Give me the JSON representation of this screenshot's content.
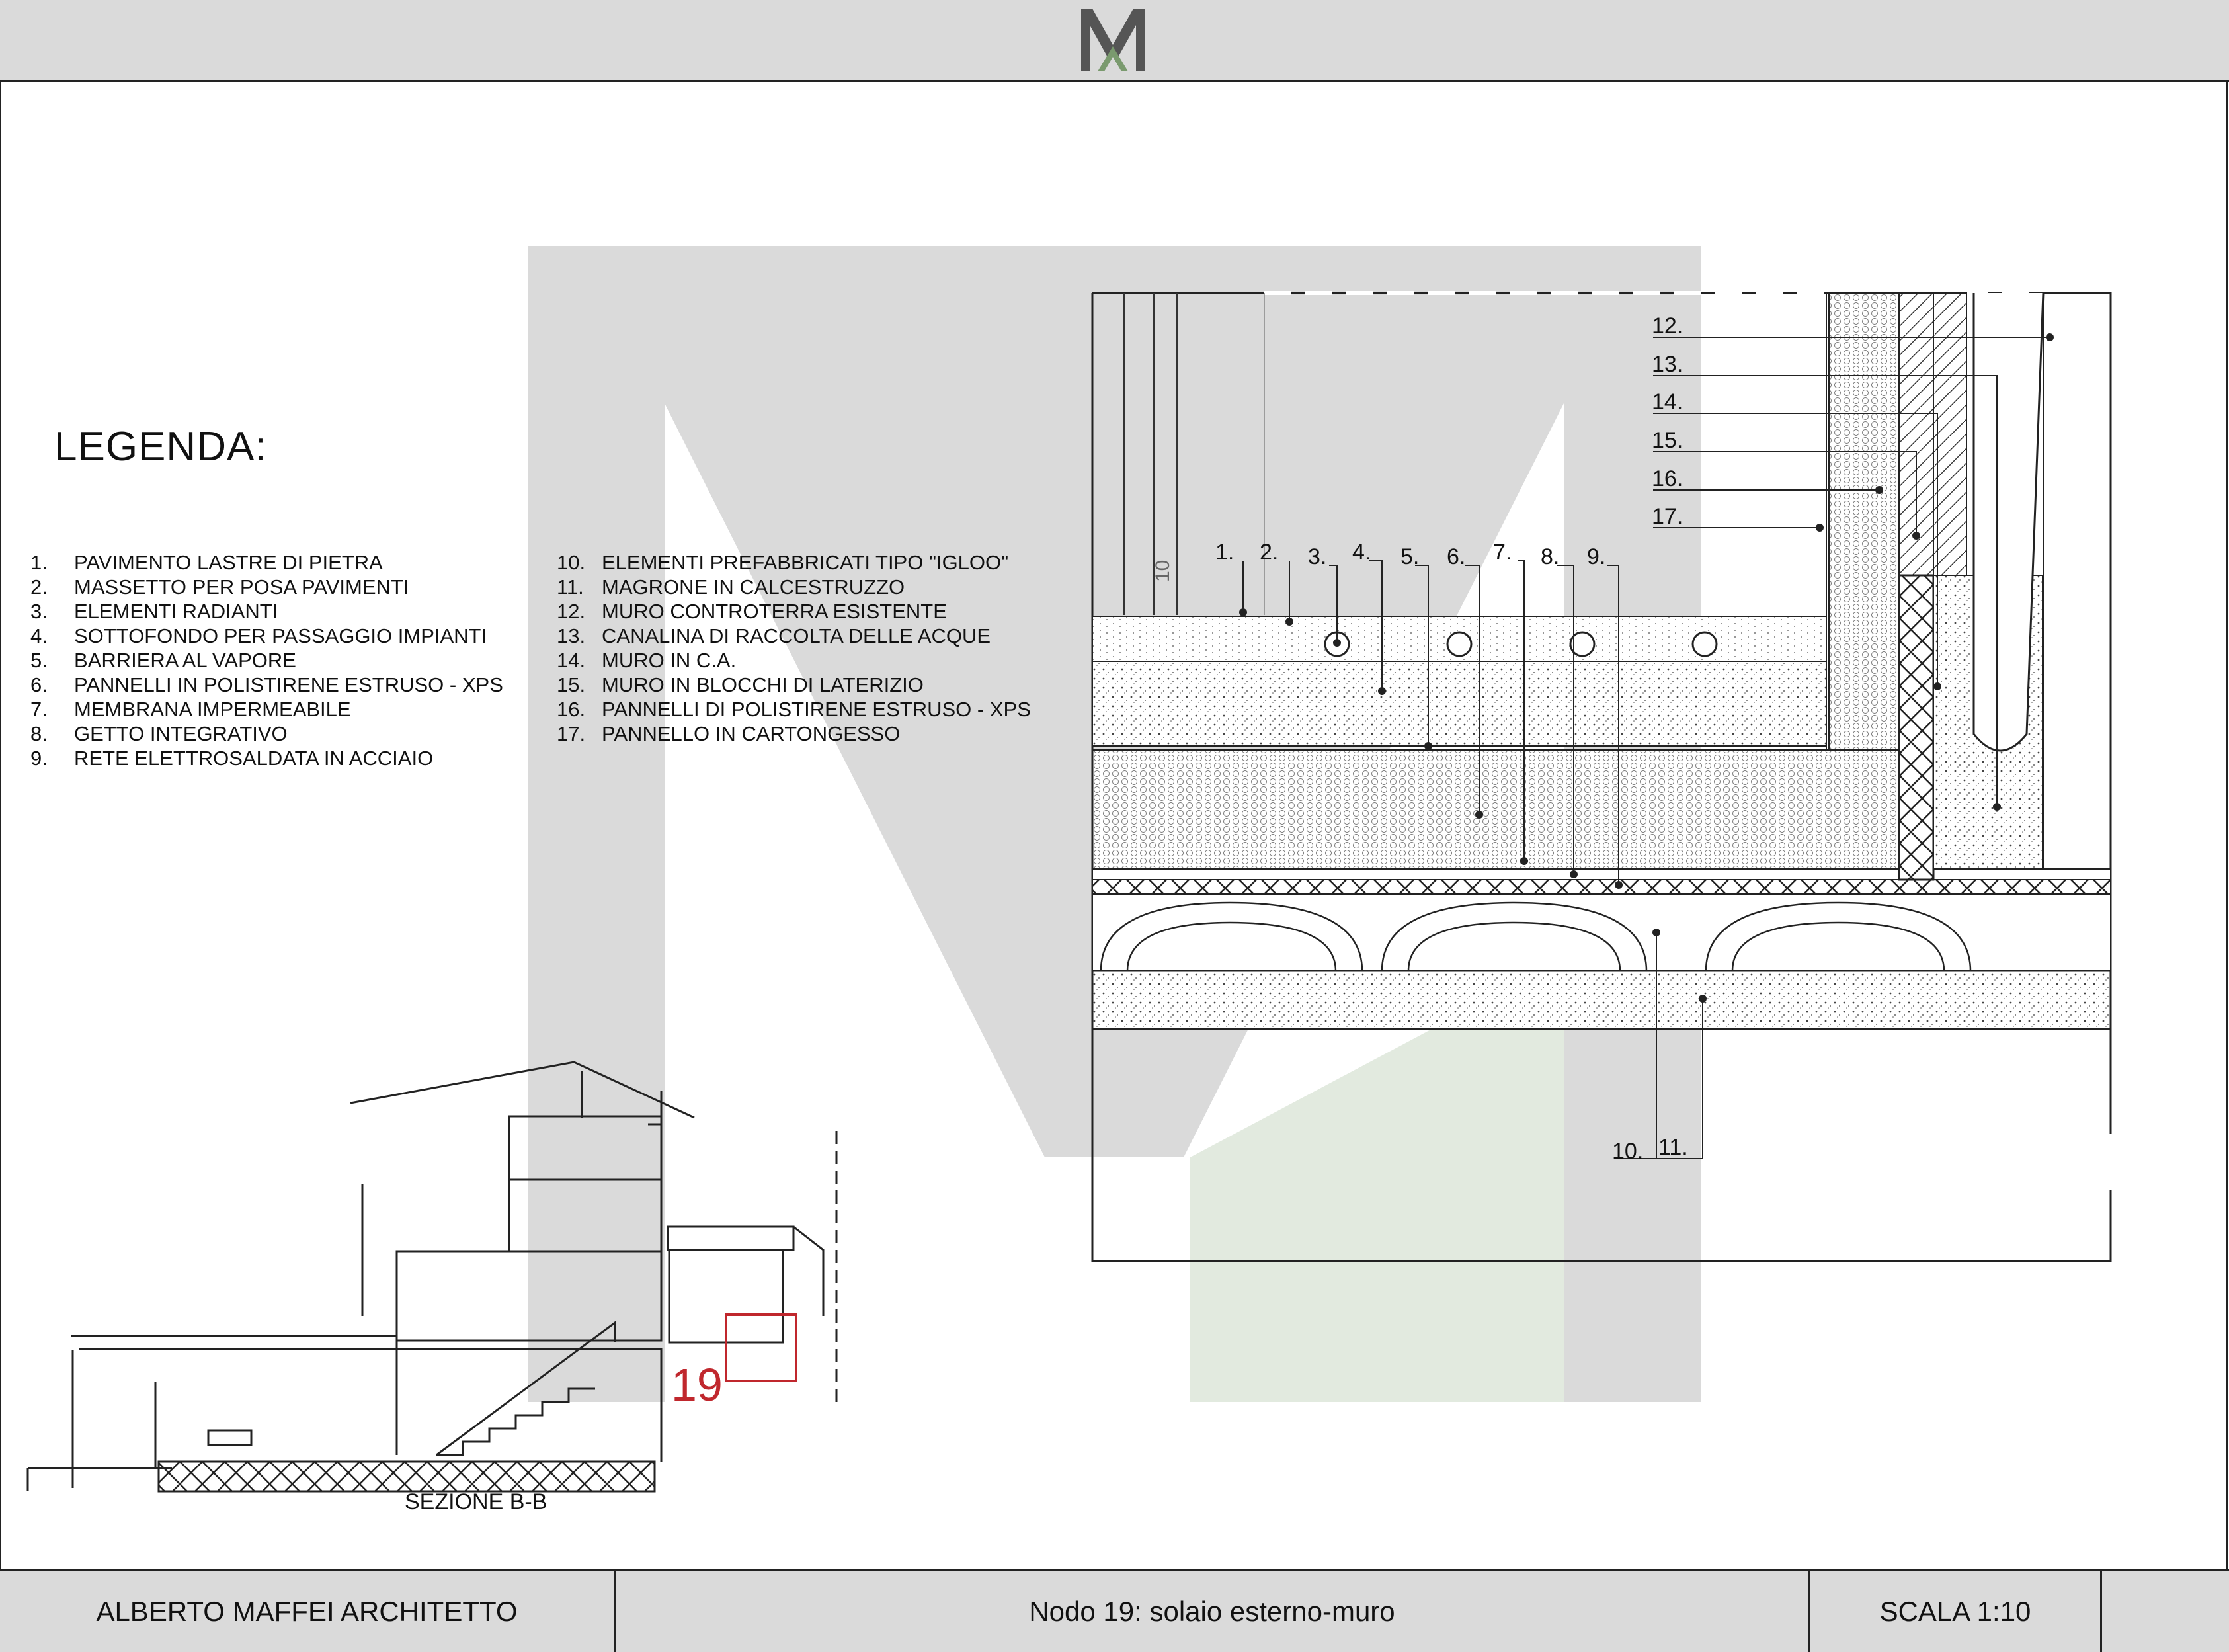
{
  "header": {
    "logo_icon": "ma-monogram-logo"
  },
  "legend": {
    "title": "LEGENDA:",
    "items": [
      {
        "num": "1.",
        "text": "PAVIMENTO LASTRE DI PIETRA"
      },
      {
        "num": "2.",
        "text": "MASSETTO PER POSA PAVIMENTI"
      },
      {
        "num": "3.",
        "text": "ELEMENTI RADIANTI"
      },
      {
        "num": "4.",
        "text": "SOTTOFONDO PER PASSAGGIO IMPIANTI"
      },
      {
        "num": "5.",
        "text": "BARRIERA AL VAPORE"
      },
      {
        "num": "6.",
        "text": "PANNELLI IN POLISTIRENE ESTRUSO - XPS"
      },
      {
        "num": "7.",
        "text": "MEMBRANA IMPERMEABILE"
      },
      {
        "num": "8.",
        "text": "GETTO INTEGRATIVO"
      },
      {
        "num": "9.",
        "text": "RETE ELETTROSALDATA IN ACCIAIO"
      },
      {
        "num": "10.",
        "text": "ELEMENTI PREFABBRICATI TIPO \"IGLOO\""
      },
      {
        "num": "11.",
        "text": "MAGRONE IN CALCESTRUZZO"
      },
      {
        "num": "12.",
        "text": "MURO CONTROTERRA ESISTENTE"
      },
      {
        "num": "13.",
        "text": "CANALINA DI RACCOLTA DELLE ACQUE"
      },
      {
        "num": "14.",
        "text": "MURO IN C.A."
      },
      {
        "num": "15.",
        "text": "MURO IN BLOCCHI DI LATERIZIO"
      },
      {
        "num": "16.",
        "text": "PANNELLI DI POLISTIRENE ESTRUSO - XPS"
      },
      {
        "num": "17.",
        "text": "PANNELLO IN CARTONGESSO"
      }
    ]
  },
  "detail": {
    "callouts_top": [
      "1.",
      "2.",
      "3.",
      "4.",
      "5.",
      "6.",
      "7.",
      "8.",
      "9."
    ],
    "callouts_right": [
      "12.",
      "13.",
      "14.",
      "15.",
      "16.",
      "17."
    ],
    "callouts_bottom": [
      "10.",
      "11."
    ],
    "vertical_dim": "10"
  },
  "section": {
    "label": "SEZIONE B-B",
    "node_marker": "19",
    "marker_color": "#c0272d"
  },
  "footer": {
    "architect": "ALBERTO MAFFEI ARCHITETTO",
    "node_title": "Nodo 19: solaio esterno-muro",
    "scale": "SCALA 1:10"
  },
  "colors": {
    "watermark_gray": "#d4d4d4",
    "watermark_green": "#dfe6da",
    "frame_bg": "#dadada"
  }
}
